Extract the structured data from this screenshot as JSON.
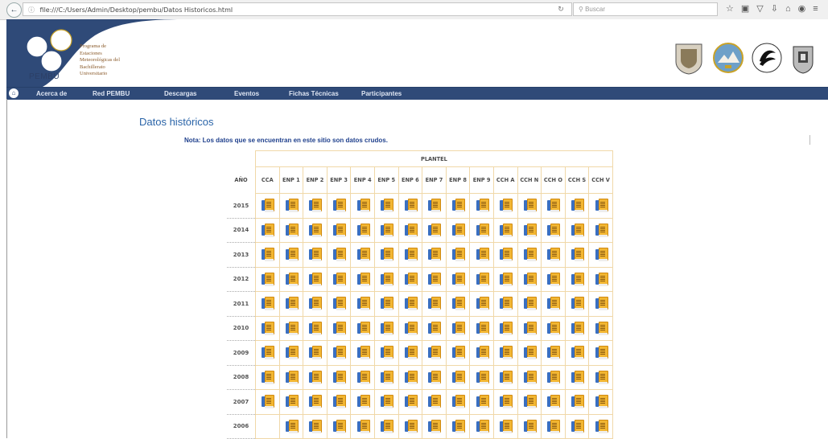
{
  "browser": {
    "url": "file:///C:/Users/Admin/Desktop/pembu/Datos Historicos.html",
    "search_placeholder": "Buscar"
  },
  "header": {
    "logo_lines": [
      "Programa de",
      "Estaciones",
      "Meteorológicas del",
      "Bachillerato",
      "Universitario"
    ],
    "logo_acronym": "PEMBU",
    "seal_icons": [
      "unam-seal-icon",
      "enp-seal-icon",
      "cch-seal-icon",
      "fes-seal-icon"
    ]
  },
  "nav": {
    "items": [
      "Acerca de",
      "Red PEMBU",
      "Descargas",
      "Eventos",
      "Fichas Técnicas",
      "Participantes"
    ]
  },
  "page": {
    "title": "Datos históricos",
    "nota": "Nota: Los datos que se encuentran en este sitio son datos crudos."
  },
  "table": {
    "group_header": "PLANTEL",
    "year_header": "AÑO",
    "columns": [
      "CCA",
      "ENP 1",
      "ENP 2",
      "ENP 3",
      "ENP 4",
      "ENP 5",
      "ENP 6",
      "ENP 7",
      "ENP 8",
      "ENP 9",
      "CCH A",
      "CCH N",
      "CCH O",
      "CCH S",
      "CCH V"
    ],
    "rows": [
      {
        "year": "2015",
        "cca": true
      },
      {
        "year": "2014",
        "cca": true
      },
      {
        "year": "2013",
        "cca": true
      },
      {
        "year": "2012",
        "cca": true
      },
      {
        "year": "2011",
        "cca": true
      },
      {
        "year": "2010",
        "cca": true
      },
      {
        "year": "2009",
        "cca": true
      },
      {
        "year": "2008",
        "cca": true
      },
      {
        "year": "2007",
        "cca": true
      },
      {
        "year": "2006",
        "cca": false
      }
    ],
    "cell_icon": "spreadsheet-download-icon"
  },
  "colors": {
    "nav_bg": "#2f4a78",
    "title": "#2a64a8",
    "nota": "#1e3f8c",
    "grid": "#f0d8a8"
  }
}
